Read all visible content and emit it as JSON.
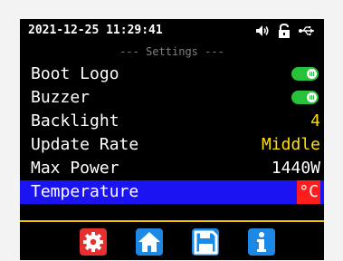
{
  "status_bar": {
    "datetime": "2021-12-25 11:29:41",
    "icons": [
      "speaker-icon",
      "unlock-icon",
      "usb-icon"
    ]
  },
  "section_title": "--- Settings ---",
  "menu": {
    "items": [
      {
        "label": "Boot Logo",
        "control": "toggle",
        "on": true
      },
      {
        "label": "Buzzer",
        "control": "toggle",
        "on": true
      },
      {
        "label": "Backlight",
        "value": "4"
      },
      {
        "label": "Update Rate",
        "value": "Middle"
      },
      {
        "label": "Max Power",
        "value": "1440W"
      },
      {
        "label": "Temperature",
        "value": "°C",
        "selected": true
      }
    ],
    "scroll_position": 0.45
  },
  "bottom_nav": [
    {
      "name": "settings-gear-icon",
      "color": "#e53030"
    },
    {
      "name": "home-icon",
      "color": "#1e88e5"
    },
    {
      "name": "save-icon",
      "color": "#1e88e5"
    },
    {
      "name": "info-icon",
      "color": "#1e88e5"
    }
  ],
  "colors": {
    "accent_yellow": "#ffe000",
    "selection_blue": "#1b13f2",
    "toggle_green": "#27c23a",
    "badge_red": "#ff1c1c",
    "divider": "#f2c400"
  }
}
